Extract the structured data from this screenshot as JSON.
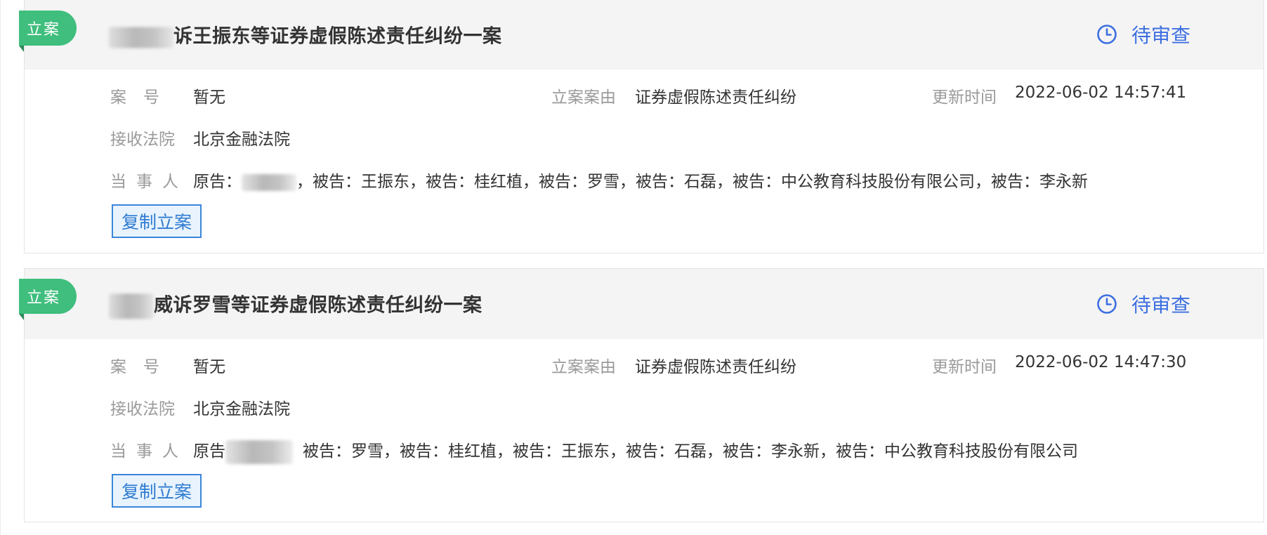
{
  "cases": [
    {
      "tag": "立案",
      "title_suffix": "诉王振东等证券虚假陈述责任纠纷一案",
      "status": "待审查",
      "case_no_label": "案号",
      "case_no": "暂无",
      "cause_label": "立案案由",
      "cause": "证券虚假陈述责任纠纷",
      "update_label": "更新时间",
      "update_time": "2022-06-02 14:57:41",
      "court_label": "接收法院",
      "court": "北京金融法院",
      "parties_label": "当事人",
      "plaintiff_prefix": "原告：",
      "defendants": "，被告：王振东，被告：桂红植，被告：罗雪，被告：石磊，被告：中公教育科技股份有限公司，被告：李永新",
      "copy_button": "复制立案"
    },
    {
      "tag": "立案",
      "title_suffix": "威诉罗雪等证券虚假陈述责任纠纷一案",
      "status": "待审查",
      "case_no_label": "案号",
      "case_no": "暂无",
      "cause_label": "立案案由",
      "cause": "证券虚假陈述责任纠纷",
      "update_label": "更新时间",
      "update_time": "2022-06-02 14:47:30",
      "court_label": "接收法院",
      "court": "北京金融法院",
      "parties_label": "当事人",
      "plaintiff_prefix": "原告",
      "defendants": "被告：罗雪，被告：桂红植，被告：王振东，被告：石磊，被告：李永新，被告：中公教育科技股份有限公司",
      "copy_button": "复制立案"
    }
  ],
  "colors": {
    "tag_green": "#3fbe7d",
    "status_blue": "#3d6fe0",
    "button_blue": "#2f7bd1",
    "header_bg": "#f4f4f5",
    "label_gray": "#9a9a9a"
  },
  "icons": {
    "status": "clock-icon"
  }
}
